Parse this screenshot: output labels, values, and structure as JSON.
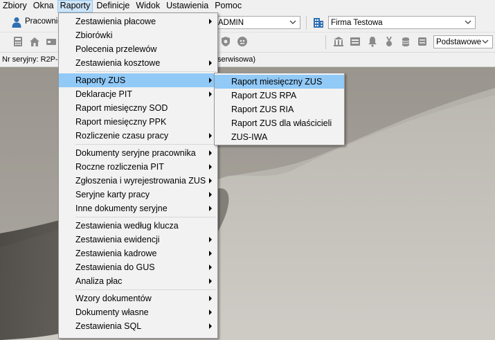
{
  "menubar": {
    "items": [
      "Zbiory",
      "Okna",
      "Raporty",
      "Definicje",
      "Widok",
      "Ustawienia",
      "Pomoc"
    ],
    "active_index": 2
  },
  "toolbar": {
    "worker_label": "Pracownic",
    "operator_value": "ADMIN",
    "company_value": "Firma Testowa",
    "view_value": "Podstawowe"
  },
  "status": {
    "left_text": "Nr seryjny: R2P-",
    "right_text": "serwisowa)"
  },
  "raporty_menu": {
    "groups": [
      [
        {
          "label": "Zestawienia płacowe",
          "submenu": true
        },
        {
          "label": "Zbiorówki",
          "submenu": false
        },
        {
          "label": "Polecenia przelewów",
          "submenu": false
        },
        {
          "label": "Zestawienia kosztowe",
          "submenu": true
        }
      ],
      [
        {
          "label": "Raporty ZUS",
          "submenu": true,
          "highlighted": true
        },
        {
          "label": "Deklaracje PIT",
          "submenu": true
        },
        {
          "label": "Raport miesięczny SOD",
          "submenu": false
        },
        {
          "label": "Raport miesięczny PPK",
          "submenu": false
        },
        {
          "label": "Rozliczenie czasu pracy",
          "submenu": true
        }
      ],
      [
        {
          "label": "Dokumenty seryjne pracownika",
          "submenu": true
        },
        {
          "label": "Roczne rozliczenia PIT",
          "submenu": true
        },
        {
          "label": "Zgłoszenia i wyrejestrowania ZUS",
          "submenu": true
        },
        {
          "label": "Seryjne karty pracy",
          "submenu": true
        },
        {
          "label": "Inne dokumenty seryjne",
          "submenu": true
        }
      ],
      [
        {
          "label": "Zestawienia według klucza",
          "submenu": false
        },
        {
          "label": "Zestawienia ewidencji",
          "submenu": true
        },
        {
          "label": "Zestawienia kadrowe",
          "submenu": true
        },
        {
          "label": "Zestawienia do GUS",
          "submenu": true
        },
        {
          "label": "Analiza płac",
          "submenu": true
        }
      ],
      [
        {
          "label": "Wzory dokumentów",
          "submenu": true
        },
        {
          "label": "Dokumenty własne",
          "submenu": true
        },
        {
          "label": "Zestawienia SQL",
          "submenu": true
        }
      ]
    ]
  },
  "zus_submenu": {
    "items": [
      {
        "label": "Raport miesięczny ZUS",
        "highlighted": true
      },
      {
        "label": "Raport ZUS RPA",
        "highlighted": false
      },
      {
        "label": "Raport ZUS RIA",
        "highlighted": false
      },
      {
        "label": "Raport ZUS dla właścicieli",
        "highlighted": false
      },
      {
        "label": "ZUS-IWA",
        "highlighted": false
      }
    ]
  },
  "colors": {
    "menu_highlight": "#91c9f7",
    "menubar_active": "#cce4f7"
  }
}
